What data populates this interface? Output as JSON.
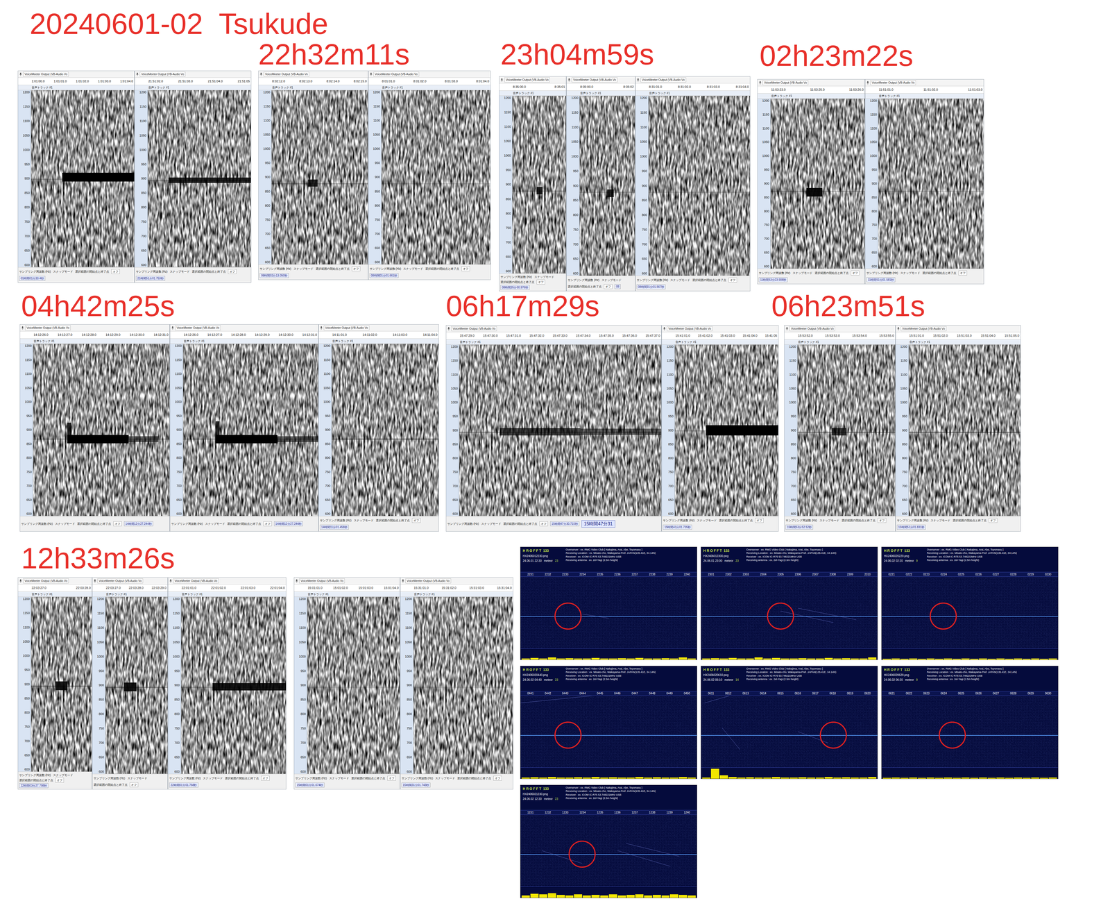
{
  "title": "20240601-02  Tsukude",
  "audacity": {
    "device": "VoiceMeeter Output (VB-Audio Vo",
    "track": "音声トラック #1",
    "rate_label": "サンプリング周波数 (Hz)",
    "snap_label": "スナップモード",
    "range_label": "選択範囲の開始点と終了点",
    "snap_value": "オフ"
  },
  "freq_ticks": [
    "1200",
    "1150",
    "1100",
    "1050",
    "1000",
    "950",
    "900",
    "850",
    "800",
    "750",
    "700",
    "650",
    "600"
  ],
  "groups": [
    {
      "panels": [
        {
          "ruler": [
            "1:01:00.0",
            "1:01:01.0",
            "1:01:02.0",
            "1:01:03.0",
            "1:01:04.0"
          ],
          "readout": "01時間01分33.4秒",
          "band": {
            "freq": 900,
            "level": 0.2
          },
          "signals": [
            {
              "start": 0.3,
              "end": 1.0,
              "freq": 905,
              "thickness": 30,
              "level": 1.0
            }
          ]
        },
        {
          "ruler": [
            "21:51:02.0",
            "21:51:03.0",
            "21:51:04.0",
            "21:51:05"
          ],
          "readout": "21時間51分01.753秒",
          "band": {
            "freq": 895,
            "level": 0.2
          },
          "signals": [
            {
              "start": 0.2,
              "end": 1.0,
              "freq": 895,
              "thickness": 18,
              "level": 0.85
            }
          ]
        }
      ]
    },
    {
      "label": "22h32m11s",
      "panels": [
        {
          "ruler": [
            "8:02:12.0",
            "8:02:13.0",
            "8:02:14.0",
            "8:02:15.0"
          ],
          "readout": "08時間02分13.050秒",
          "band": {
            "freq": 880,
            "level": 0.25
          },
          "signals": [
            {
              "start": 0.38,
              "end": 0.48,
              "freq": 880,
              "thickness": 25,
              "level": 0.85
            }
          ]
        },
        {
          "ruler": [
            "8:01:01.0",
            "8:01:02.0",
            "8:01:03.0",
            "8:01:04.0"
          ],
          "readout": "08時間01分01.661秒",
          "band": {
            "freq": 880,
            "level": 0.15
          },
          "signals": []
        }
      ]
    },
    {
      "label": "23h04m59s",
      "panels": [
        {
          "ruler": [
            "8:35:00.0",
            "8:35:01"
          ],
          "readout": "08時間35分00.976秒",
          "band": {
            "freq": 880,
            "level": 0.2
          },
          "signals": [
            {
              "start": 0.45,
              "end": 0.56,
              "freq": 880,
              "thickness": 25,
              "level": 0.85
            }
          ]
        },
        {
          "ruler": [
            "8:35:00.0",
            "8:35:02"
          ],
          "readout": "08",
          "band": {
            "freq": 880,
            "level": 0.2
          },
          "signals": [
            {
              "start": 0.5,
              "end": 0.62,
              "freq": 875,
              "thickness": 25,
              "level": 0.85
            }
          ]
        },
        {
          "ruler": [
            "8:31:01.0",
            "8:31:02.0",
            "8:31:03.0",
            "8:31:04.0"
          ],
          "readout": "08時間31分01.567秒",
          "band": {
            "freq": 880,
            "level": 0.15
          },
          "signals": []
        }
      ]
    },
    {
      "label": "02h23m22s",
      "panels": [
        {
          "ruler": [
            "11:53:23.0",
            "11:53:25.0",
            "11:53:26.0"
          ],
          "readout": "11時間53分23.908秒",
          "band": {
            "freq": 875,
            "level": 0.2
          },
          "signals": [
            {
              "start": 0.38,
              "end": 0.55,
              "freq": 870,
              "thickness": 30,
              "level": 0.95
            }
          ]
        },
        {
          "ruler": [
            "11:51:01.0",
            "11:51:02.0",
            "11:51:03.0"
          ],
          "readout": "11時間51分01.581秒",
          "band": {
            "freq": 875,
            "level": 0.15
          },
          "signals": []
        }
      ]
    },
    {
      "label": "04h42m25s",
      "panels": [
        {
          "ruler": [
            "14:12:26.0",
            "14:12:27.0",
            "14:12:28.0",
            "14:12:29.0",
            "14:12:30.0",
            "14:12:31.0"
          ],
          "readout": "14時間12分27.244秒",
          "band": {
            "freq": 870,
            "level": 0.25
          },
          "signals": [
            {
              "start": 0.25,
              "end": 0.28,
              "freq": 900,
              "thickness": 50,
              "level": 0.8
            },
            {
              "start": 0.25,
              "end": 0.7,
              "freq": 868,
              "thickness": 30,
              "level": 1.0
            },
            {
              "start": 0.7,
              "end": 0.92,
              "freq": 868,
              "thickness": 20,
              "level": 0.6
            }
          ]
        },
        {
          "ruler": [
            "14:12:26.0",
            "14:12:27.0",
            "14:12:28.0",
            "14:12:29.0",
            "14:12:30.0",
            "14:12:31.0"
          ],
          "readout": "14時間12分27.244秒",
          "band": {
            "freq": 870,
            "level": 0.25
          },
          "signals": [
            {
              "start": 0.24,
              "end": 0.27,
              "freq": 905,
              "thickness": 50,
              "level": 0.8
            },
            {
              "start": 0.24,
              "end": 0.7,
              "freq": 868,
              "thickness": 30,
              "level": 1.0
            },
            {
              "start": 0.7,
              "end": 1.0,
              "freq": 868,
              "thickness": 20,
              "level": 0.6
            }
          ]
        },
        {
          "ruler": [
            "14:11:01.0",
            "14:11:02.0",
            "14:11:03.0",
            "14:11:04.0"
          ],
          "readout": "14時間11分01.458秒",
          "band": {
            "freq": 870,
            "level": 0.35
          },
          "signals": []
        }
      ]
    },
    {
      "label": "06h17m29s",
      "panels": [
        {
          "ruler": [
            "15:47:29.0",
            "15:47:30.0",
            "15:47:31.0",
            "15:47:32.0",
            "15:47:33.0",
            "15:47:34.0",
            "15:47:35.0",
            "15:47:36.0",
            "15:47:37.0"
          ],
          "readout": "15時間47分30.715秒",
          "note": "15時間47分31",
          "band": {
            "freq": 895,
            "level": 0.25
          },
          "signals": [
            {
              "start": 0.2,
              "end": 0.6,
              "freq": 895,
              "thickness": 25,
              "level": 0.7
            },
            {
              "start": 0.6,
              "end": 1.0,
              "freq": 895,
              "thickness": 22,
              "level": 0.55
            }
          ]
        },
        {
          "ruler": [
            "15:41:01.0",
            "15:41:02.0",
            "15:41:03.0",
            "15:41:04.0",
            "15:41:05"
          ],
          "readout": "15時間41分01.735秒",
          "band": {
            "freq": 900,
            "level": 0.2
          },
          "signals": [
            {
              "start": 0.3,
              "end": 1.0,
              "freq": 900,
              "thickness": 35,
              "level": 1.0
            }
          ]
        }
      ]
    },
    {
      "label": "06h23m51s",
      "panels": [
        {
          "ruler": [
            "15:53:52.0",
            "15:53:53.0",
            "15:53:54.0",
            "15:53:55.0"
          ],
          "readout": "15時間53分52.52秒",
          "band": {
            "freq": 895,
            "level": 0.3
          },
          "signals": [
            {
              "start": 0.35,
              "end": 0.5,
              "freq": 895,
              "thickness": 25,
              "level": 0.75
            }
          ]
        },
        {
          "ruler": [
            "15:51:01.0",
            "15:51:02.0",
            "15:51:03.0",
            "15:51:04.0",
            "15:51:05.0"
          ],
          "readout": "15時間51分01.831秒",
          "band": {
            "freq": 895,
            "level": 0.35
          },
          "signals": []
        }
      ]
    },
    {
      "label": "12h33m26s",
      "panels": [
        {
          "ruler": [
            "22:03:27.0",
            "22:03:28.0"
          ],
          "readout": "22時間03分27.798秒",
          "band": {
            "freq": 895,
            "level": 0.3
          },
          "signals": [
            {
              "start": 0.4,
              "end": 0.6,
              "freq": 895,
              "thickness": 30,
              "level": 0.9
            }
          ]
        },
        {
          "ruler": [
            "22:03:27.0",
            "22:03:28.0",
            "22:03:29.0"
          ],
          "band": {
            "freq": 895,
            "level": 0.3
          },
          "signals": [
            {
              "start": 0.3,
              "end": 0.5,
              "freq": 895,
              "thickness": 30,
              "level": 0.9
            }
          ]
        },
        {
          "ruler": [
            "22:01:01.0",
            "22:01:02.0",
            "22:01:03.0",
            "22:01:04.0"
          ],
          "readout": "22時間01分01.768秒",
          "band": {
            "freq": 895,
            "level": 0.2
          },
          "signals": [
            {
              "start": 0.3,
              "end": 1.0,
              "freq": 895,
              "thickness": 25,
              "level": 0.9
            }
          ]
        }
      ]
    },
    {
      "panels": [
        {
          "ruler": [
            "15:01:01.0",
            "15:01:02.0",
            "15:01:03.0",
            "15:01:04.0"
          ],
          "readout": "15時間01分01.674秒",
          "band": {
            "freq": 895,
            "level": 0.1
          },
          "signals": []
        },
        {
          "ruler": [
            "15:31:01.0",
            "15:31:02.0",
            "15:31:03.0",
            "15:31:04.0"
          ],
          "readout": "15時間31分01.743秒",
          "band": {
            "freq": 895,
            "level": 0.1
          },
          "signals": []
        }
      ]
    }
  ],
  "hrofft": {
    "header": "H R O F F T  133",
    "meteor_label": "meteor",
    "info": [
      "Overserver : ex. RMG Video Club [ Nakajima, Arai, Abe, Toyomasu ]",
      "Receiving Location : ex. Misato-cho, Wakayama-Pref. JAPAN(135.41E, 34.14N)",
      "Receiver : ex. ICOM IC-R75 53.748221MHz USB",
      "Receiving antenna : ex. 2el-Yagi (2.5m height)"
    ],
    "items": [
      {
        "file": "HX2406012230.png",
        "datetime": "24.06.01 22:30",
        "meteors": "23",
        "times": [
          "2231",
          "2232",
          "2233",
          "2234",
          "2235",
          "2236",
          "2237",
          "2238",
          "2239",
          "2240"
        ],
        "circle": 0.27,
        "streaks": [
          [
            0.35,
            0.52,
            0.5,
            0.58
          ]
        ],
        "histogram": [
          0.1,
          0.15,
          0.1,
          0.2,
          0.1,
          0.12,
          0.1,
          0.1,
          0.15,
          0.1,
          0.1,
          0.12,
          0.1,
          0.15,
          0.1,
          0.1,
          0.12,
          0.1,
          0.2,
          0.1
        ]
      },
      {
        "file": "HX2406012300.png",
        "datetime": "24.06.01 23:00",
        "meteors": "23",
        "times": [
          "2301",
          "2302",
          "2303",
          "2304",
          "2305",
          "2306",
          "2307",
          "2308",
          "2309",
          "2310"
        ],
        "circle": 0.45,
        "streaks": [
          [
            0.45,
            0.48,
            0.75,
            0.64
          ],
          [
            0.55,
            0.44,
            0.88,
            0.6
          ]
        ],
        "histogram": [
          0.1,
          0.12,
          0.1,
          0.15,
          0.1,
          0.1,
          0.2,
          0.1,
          0.15,
          0.1,
          0.1,
          0.12,
          0.1,
          0.1,
          0.15,
          0.1,
          0.12,
          0.1,
          0.1,
          0.2
        ]
      },
      {
        "file": "HX2406020220.png",
        "datetime": "24.06.02 02:20",
        "meteors": "9",
        "times": [
          "0221",
          "0222",
          "0223",
          "0224",
          "0225",
          "0226",
          "0227",
          "0228",
          "0229",
          "0230"
        ],
        "circle": 0.35,
        "streaks": [],
        "histogram": [
          0.08,
          0.1,
          0.08,
          0.1,
          0.08,
          0.1,
          0.08,
          0.1,
          0.08,
          0.1,
          0.08,
          0.1,
          0.08,
          0.1,
          0.08,
          0.1,
          0.08,
          0.1,
          0.08,
          0.1
        ]
      },
      {
        "file": "HX2406020440.png",
        "datetime": "24.06.02 04:40",
        "meteors": "23",
        "times": [
          "0441",
          "0442",
          "0443",
          "0444",
          "0445",
          "0446",
          "0447",
          "0448",
          "0449",
          "0450"
        ],
        "circle": 0.27,
        "streaks": [
          [
            0.0,
            0.1,
            1.0,
            -0.15
          ]
        ],
        "histogram": [
          0.1,
          0.12,
          0.1,
          0.15,
          0.1,
          0.1,
          0.12,
          0.1,
          0.15,
          0.1,
          0.12,
          0.1,
          0.1,
          0.15,
          0.1,
          0.12,
          0.1,
          0.1,
          0.15,
          0.1
        ]
      },
      {
        "file": "HX2406020610.png",
        "datetime": "24.06.02 06:10",
        "meteors": "14",
        "times": [
          "0611",
          "0612",
          "0613",
          "0614",
          "0615",
          "0616",
          "0617",
          "0618",
          "0619",
          "0620"
        ],
        "circle": 0.75,
        "streaks": [
          [
            0.12,
            0.45,
            0.22,
            0.75
          ],
          [
            0.55,
            0.5,
            0.72,
            0.66
          ],
          [
            0.02,
            0.1,
            0.3,
            -0.1
          ]
        ],
        "histogram": [
          0.1,
          0.9,
          0.3,
          0.15,
          0.1,
          0.12,
          0.1,
          0.1,
          0.15,
          0.1,
          0.1,
          0.12,
          0.1,
          0.1,
          0.15,
          0.1,
          0.12,
          0.1,
          0.1,
          0.15
        ]
      },
      {
        "file": "HX2406020620.png",
        "datetime": "24.06.02 06:20",
        "meteors": "9",
        "times": [
          "0621",
          "0622",
          "0623",
          "0624",
          "0625",
          "0626",
          "0627",
          "0628",
          "0629",
          "0630"
        ],
        "circle": 0.4,
        "streaks": [],
        "histogram": [
          0.08,
          0.1,
          0.08,
          0.1,
          0.08,
          0.1,
          0.08,
          0.1,
          0.08,
          0.1,
          0.08,
          0.1,
          0.08,
          0.1,
          0.08,
          0.1,
          0.08,
          0.1,
          0.08,
          0.1
        ]
      },
      {
        "file": "HX2406021230.png",
        "datetime": "24.06.02 12:30",
        "meteors": "23",
        "times": [
          "1231",
          "1232",
          "1233",
          "1234",
          "1235",
          "1236",
          "1237",
          "1238",
          "1239",
          "1240"
        ],
        "circle": 0.35,
        "streaks": [
          [
            0.12,
            0.5,
            0.35,
            0.68
          ],
          [
            0.55,
            0.5,
            0.85,
            0.72
          ],
          [
            0.6,
            0.4,
            0.9,
            0.58
          ]
        ],
        "histogram": [
          0.2,
          0.35,
          0.3,
          0.4,
          0.25,
          0.2,
          0.3,
          0.2,
          0.25,
          0.2,
          0.3,
          0.2,
          0.25,
          0.3,
          0.2,
          0.25,
          0.2,
          0.3,
          0.25,
          0.2
        ]
      }
    ]
  }
}
